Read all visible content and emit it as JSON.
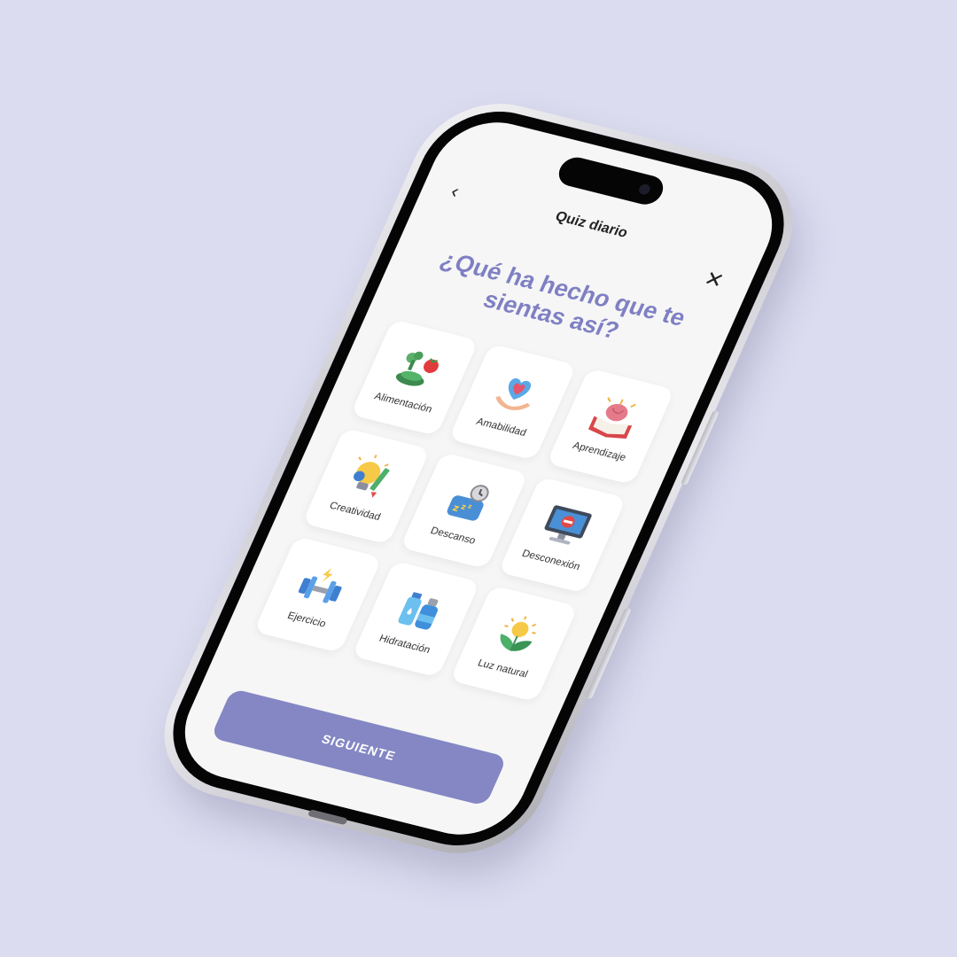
{
  "header": {
    "back_icon": "chevron-left-icon",
    "title": "Quiz diario",
    "close_icon": "close-icon"
  },
  "question": "¿Qué ha hecho que te sientas así?",
  "options": [
    {
      "label": "Alimentación",
      "icon": "vegetables-icon"
    },
    {
      "label": "Amabilidad",
      "icon": "heart-hands-icon"
    },
    {
      "label": "Aprendizaje",
      "icon": "brain-book-icon"
    },
    {
      "label": "Creatividad",
      "icon": "lightbulb-pencil-icon"
    },
    {
      "label": "Descanso",
      "icon": "sleep-pillow-icon"
    },
    {
      "label": "Desconexión",
      "icon": "monitor-off-icon"
    },
    {
      "label": "Ejercicio",
      "icon": "dumbbell-icon"
    },
    {
      "label": "Hidratación",
      "icon": "water-bottles-icon"
    },
    {
      "label": "Luz natural",
      "icon": "sun-plant-icon"
    }
  ],
  "cta_label": "SIGUIENTE",
  "colors": {
    "background": "#dcdcf0",
    "accent": "#7f80c3",
    "button": "#8487c4",
    "screen": "#f6f6f6"
  }
}
